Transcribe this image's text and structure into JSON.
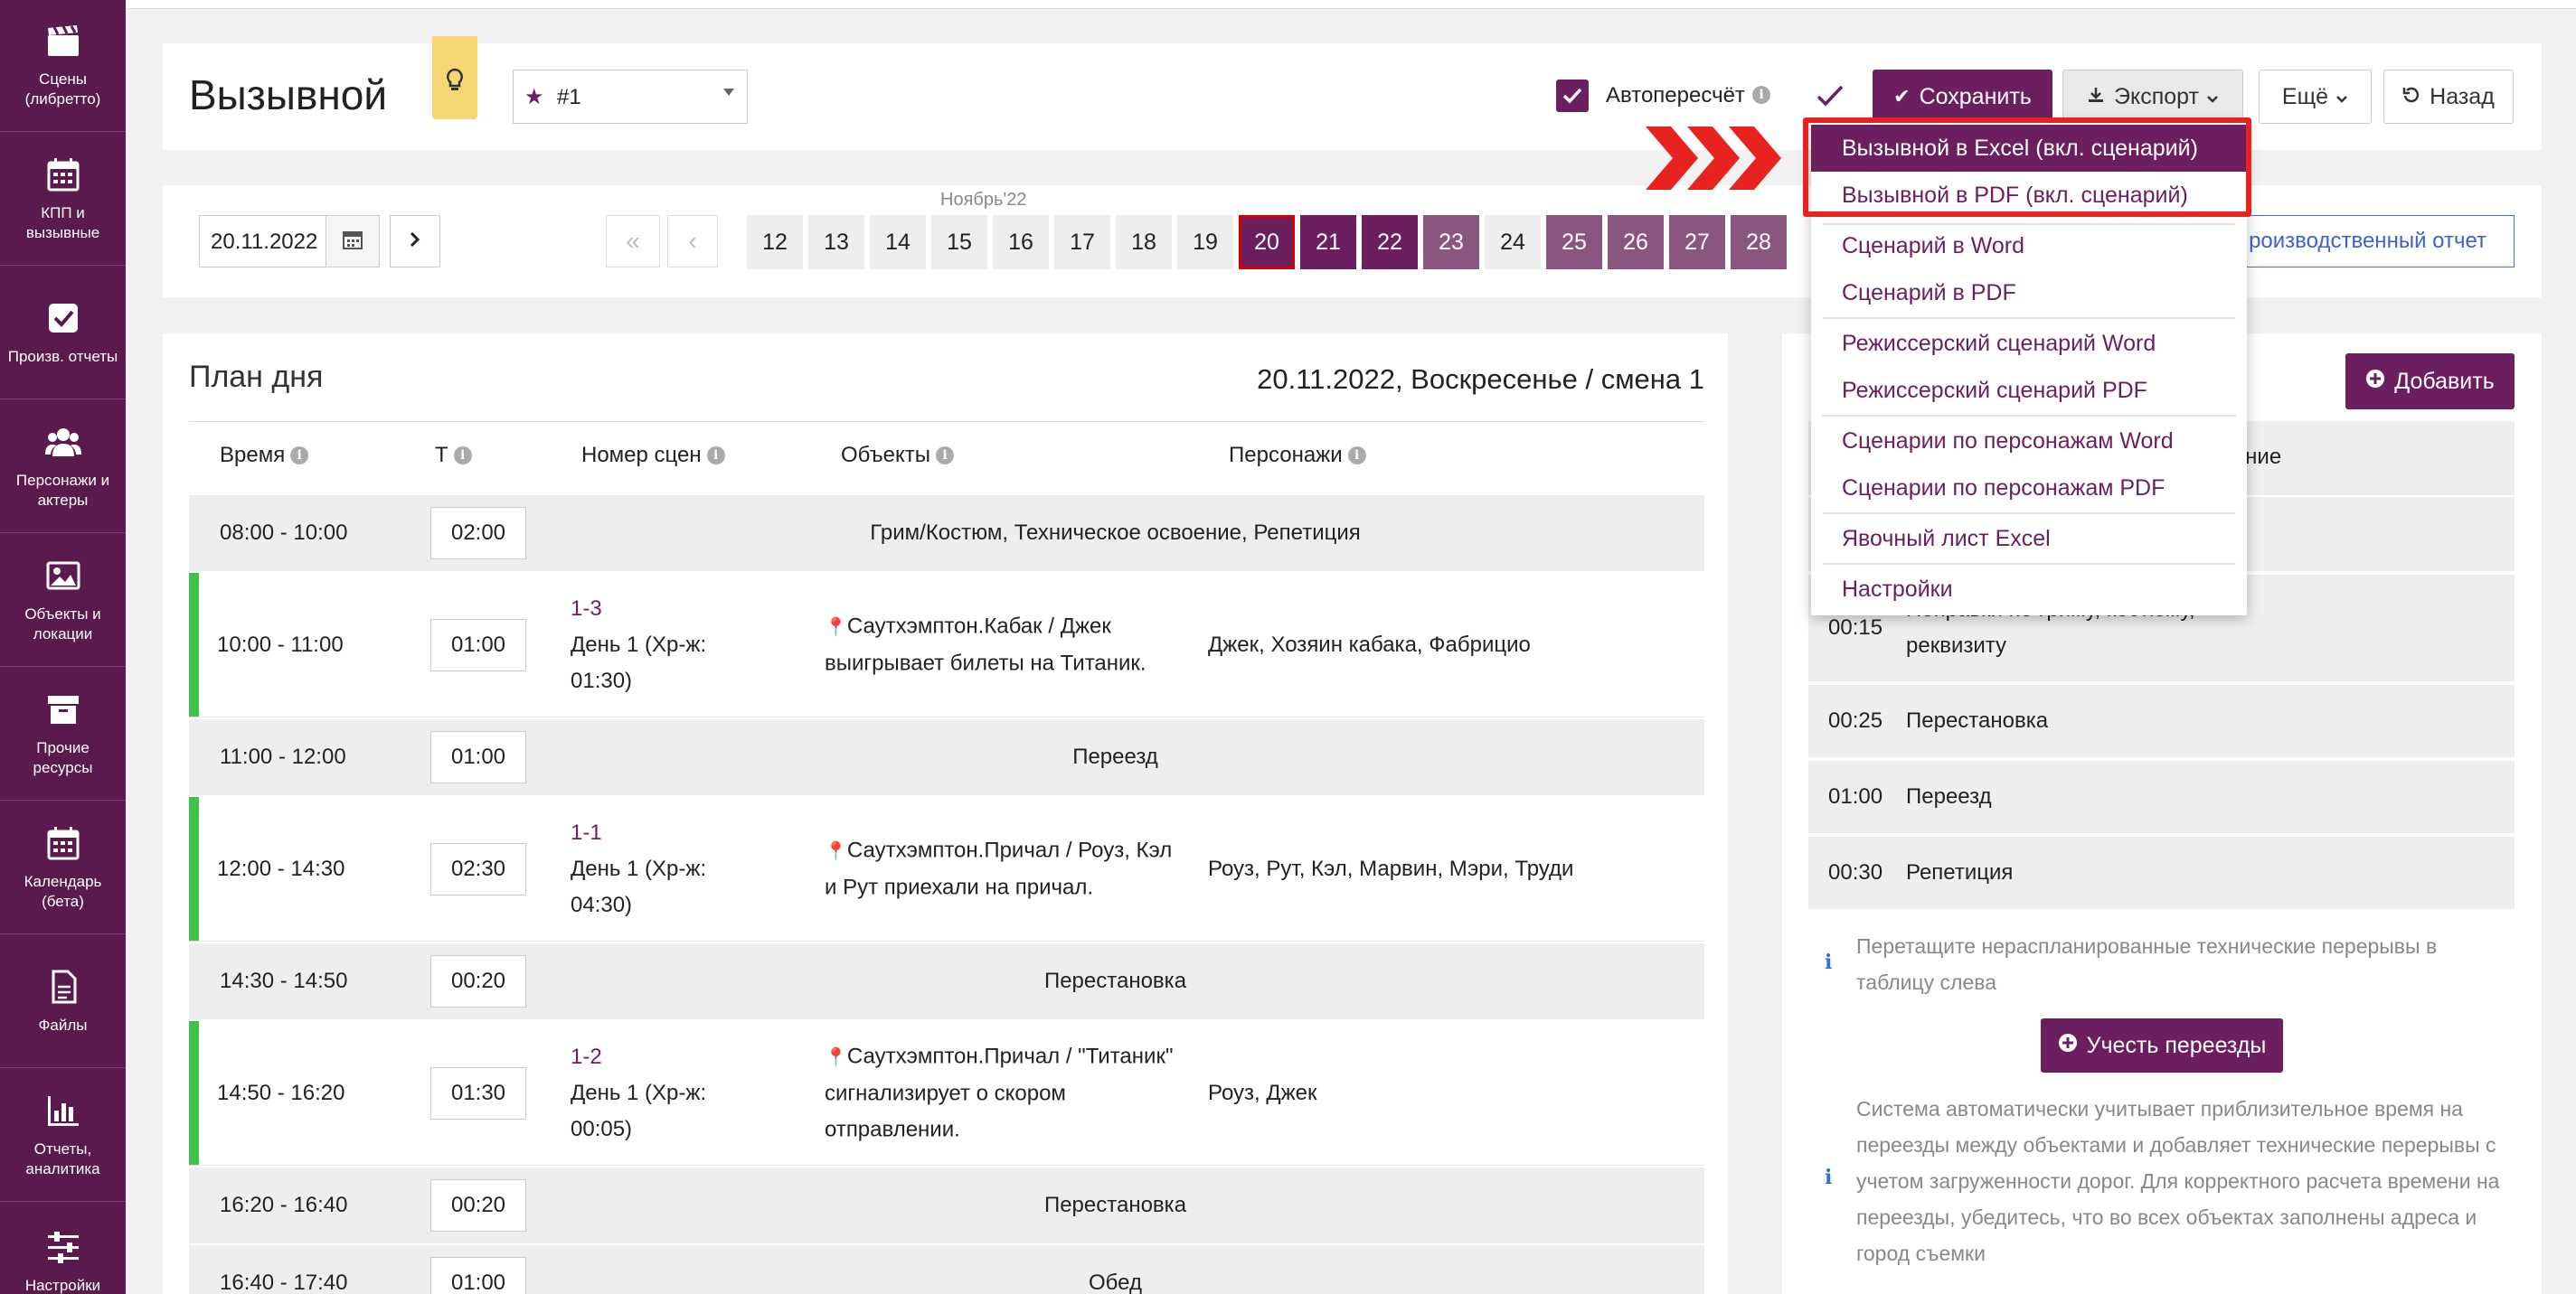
{
  "sidebar": {
    "items": [
      {
        "label": "Сцены (либретто)",
        "icon": "clapperboard-icon"
      },
      {
        "label": "КПП и вызывные",
        "icon": "calendar-icon"
      },
      {
        "label": "Произв. отчеты",
        "icon": "checkbox-icon"
      },
      {
        "label": "Персонажи и актеры",
        "icon": "people-icon"
      },
      {
        "label": "Объекты и локации",
        "icon": "image-icon"
      },
      {
        "label": "Прочие ресурсы",
        "icon": "archive-icon"
      },
      {
        "label": "Календарь (бета)",
        "icon": "calendar-icon"
      },
      {
        "label": "Файлы",
        "icon": "file-icon"
      },
      {
        "label": "Отчеты, аналитика",
        "icon": "bar-chart-icon"
      },
      {
        "label": "Настройки",
        "icon": "sliders-icon"
      }
    ]
  },
  "header": {
    "title": "Вызывной",
    "version_select": "#1",
    "autorecalc_label": "Автопересчёт",
    "autorecalc_checked": true,
    "save_label": "Сохранить",
    "export_label": "Экспорт",
    "more_label": "Ещё",
    "back_label": "Назад"
  },
  "datebar": {
    "date_value": "20.11.2022",
    "month_label": "Ноябрь'22",
    "days": [
      {
        "label": "12",
        "state": "plain"
      },
      {
        "label": "13",
        "state": "plain"
      },
      {
        "label": "14",
        "state": "plain"
      },
      {
        "label": "15",
        "state": "plain"
      },
      {
        "label": "16",
        "state": "plain"
      },
      {
        "label": "17",
        "state": "plain"
      },
      {
        "label": "18",
        "state": "plain"
      },
      {
        "label": "19",
        "state": "plain"
      },
      {
        "label": "20",
        "state": "today"
      },
      {
        "label": "21",
        "state": "purple"
      },
      {
        "label": "22",
        "state": "purple"
      },
      {
        "label": "23",
        "state": "muted"
      },
      {
        "label": "24",
        "state": "plain"
      },
      {
        "label": "25",
        "state": "muted"
      },
      {
        "label": "26",
        "state": "muted"
      },
      {
        "label": "27",
        "state": "muted"
      },
      {
        "label": "28",
        "state": "muted"
      }
    ],
    "report_link": "роизводственный отчет"
  },
  "plan": {
    "title": "План дня",
    "date_info": "20.11.2022, Воскресенье / смена 1",
    "columns": {
      "time": "Время",
      "duration": "Т",
      "scenes": "Номер сцен",
      "objects": "Объекты",
      "characters": "Персонажи"
    },
    "rows": [
      {
        "time": "08:00 - 10:00",
        "dur": "02:00",
        "center": "Грим/Костюм, Техническое освоение, Репетиция"
      },
      {
        "time": "10:00 - 11:00",
        "dur": "01:00",
        "scene_link": "1-3",
        "scene_l1": "День 1 (Хр-ж:",
        "scene_l2": "01:30)",
        "obj": "Саутхэмптон.Кабак / Джек выигрывает билеты на Титаник.",
        "pers": "Джек, Хозяин кабака, Фабрицио"
      },
      {
        "time": "11:00 - 12:00",
        "dur": "01:00",
        "center": "Переезд"
      },
      {
        "time": "12:00 - 14:30",
        "dur": "02:30",
        "scene_link": "1-1",
        "scene_l1": "День 1 (Хр-ж:",
        "scene_l2": "04:30)",
        "obj": "Саутхэмптон.Причал / Роуз, Кэл и Рут приехали на причал.",
        "pers": "Роуз, Рут, Кэл, Марвин, Мэри, Труди"
      },
      {
        "time": "14:30 - 14:50",
        "dur": "00:20",
        "center": "Перестановка"
      },
      {
        "time": "14:50 - 16:20",
        "dur": "01:30",
        "scene_link": "1-2",
        "scene_l1": "День 1 (Хр-ж:",
        "scene_l2": "00:05)",
        "obj": "Саутхэмптон.Причал / \"Титаник\" сигнализирует о скором отправлении.",
        "pers": "Роуз, Джек"
      },
      {
        "time": "16:20 - 16:40",
        "dur": "00:20",
        "center": "Перестановка"
      },
      {
        "time": "16:40 - 17:40",
        "dur": "01:00",
        "center": "Обед"
      }
    ]
  },
  "right_panel": {
    "add_label": "Добавить",
    "header_partial": "своение",
    "rows": [
      {
        "time": "00:15",
        "name": "Поправки по гриму, костюму, реквизиту"
      },
      {
        "time": "00:25",
        "name": "Перестановка"
      },
      {
        "time": "01:00",
        "name": "Переезд"
      },
      {
        "time": "00:30",
        "name": "Репетиция"
      }
    ],
    "hint1": "Перетащите нераспланированные технические перерывы в таблицу слева",
    "account_label": "Учесть переезды",
    "hint2": "Система автоматически учитывает приблизительное время на переезды между объектами и добавляет технические перерывы с учетом загруженности дорог. Для корректного расчета времени на переезды, убедитесь, что во всех объектах заполнены адреса и город съемки"
  },
  "export_menu": {
    "items": [
      "Вызывной в Excel (вкл. сценарий)",
      "Вызывной в PDF (вкл. сценарий)",
      "Сценарий в Word",
      "Сценарий в PDF",
      "Режиссерский сценарий Word",
      "Режиссерский сценарий PDF",
      "Сценарии по персонажам Word",
      "Сценарии по персонажам PDF",
      "Явочный лист Excel",
      "Настройки"
    ]
  },
  "colors": {
    "sidebar": "#5a1a4e",
    "accent": "#6c1f5f",
    "muted_day": "#8a5680",
    "highlight_box": "#e8231f",
    "scheduled_bar": "#3fc24a",
    "tip_badge": "#f7d774"
  }
}
